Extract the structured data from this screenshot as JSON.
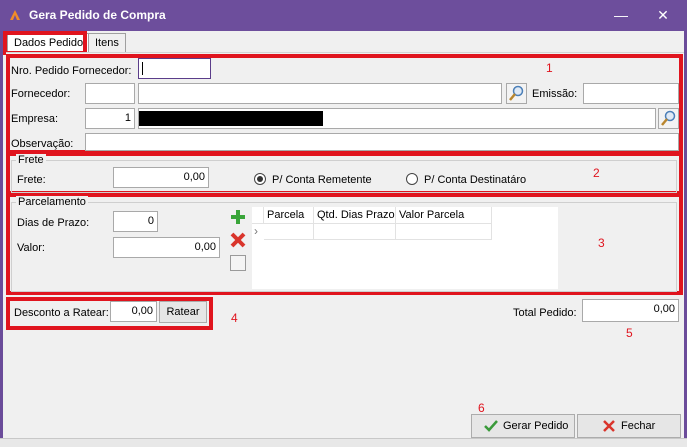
{
  "window": {
    "title": "Gera Pedido de Compra",
    "minimize_glyph": "—",
    "close_glyph": "✕",
    "icon": "app-logo-icon"
  },
  "tabs": [
    {
      "label": "Dados Pedido",
      "active": true
    },
    {
      "label": "Itens",
      "active": false
    }
  ],
  "annotations": {
    "n1": "1",
    "n2": "2",
    "n3": "3",
    "n4": "4",
    "n5": "5",
    "n6": "6",
    "color": "#e0141e"
  },
  "section1": {
    "nro_label": "Nro. Pedido Fornecedor:",
    "nro_value": "",
    "fornecedor_label": "Fornecedor:",
    "fornecedor_code": "",
    "fornecedor_name": "",
    "emissao_label": "Emissão:",
    "emissao_value": "",
    "empresa_label": "Empresa:",
    "empresa_code": "1",
    "observacao_label": "Observação:",
    "observacao_value": ""
  },
  "frete": {
    "legend": "Frete",
    "label": "Frete:",
    "value": "0,00",
    "option_remetente": "P/ Conta Remetente",
    "option_destinatario": "P/ Conta Destinatáro",
    "selected": "remetente"
  },
  "parcelamento": {
    "legend": "Parcelamento",
    "dias_label": "Dias de Prazo:",
    "dias_value": "0",
    "valor_label": "Valor:",
    "valor_value": "0,00",
    "grid_columns": [
      "Parcela",
      "Qtd. Dias Prazo",
      "Valor Parcela"
    ],
    "row_indicator": "›"
  },
  "desconto": {
    "label": "Desconto a Ratear:",
    "value": "0,00",
    "button": "Ratear"
  },
  "total": {
    "label": "Total Pedido:",
    "value": "0,00"
  },
  "footer": {
    "gerar_label": "Gerar Pedido",
    "fechar_label": "Fechar"
  }
}
